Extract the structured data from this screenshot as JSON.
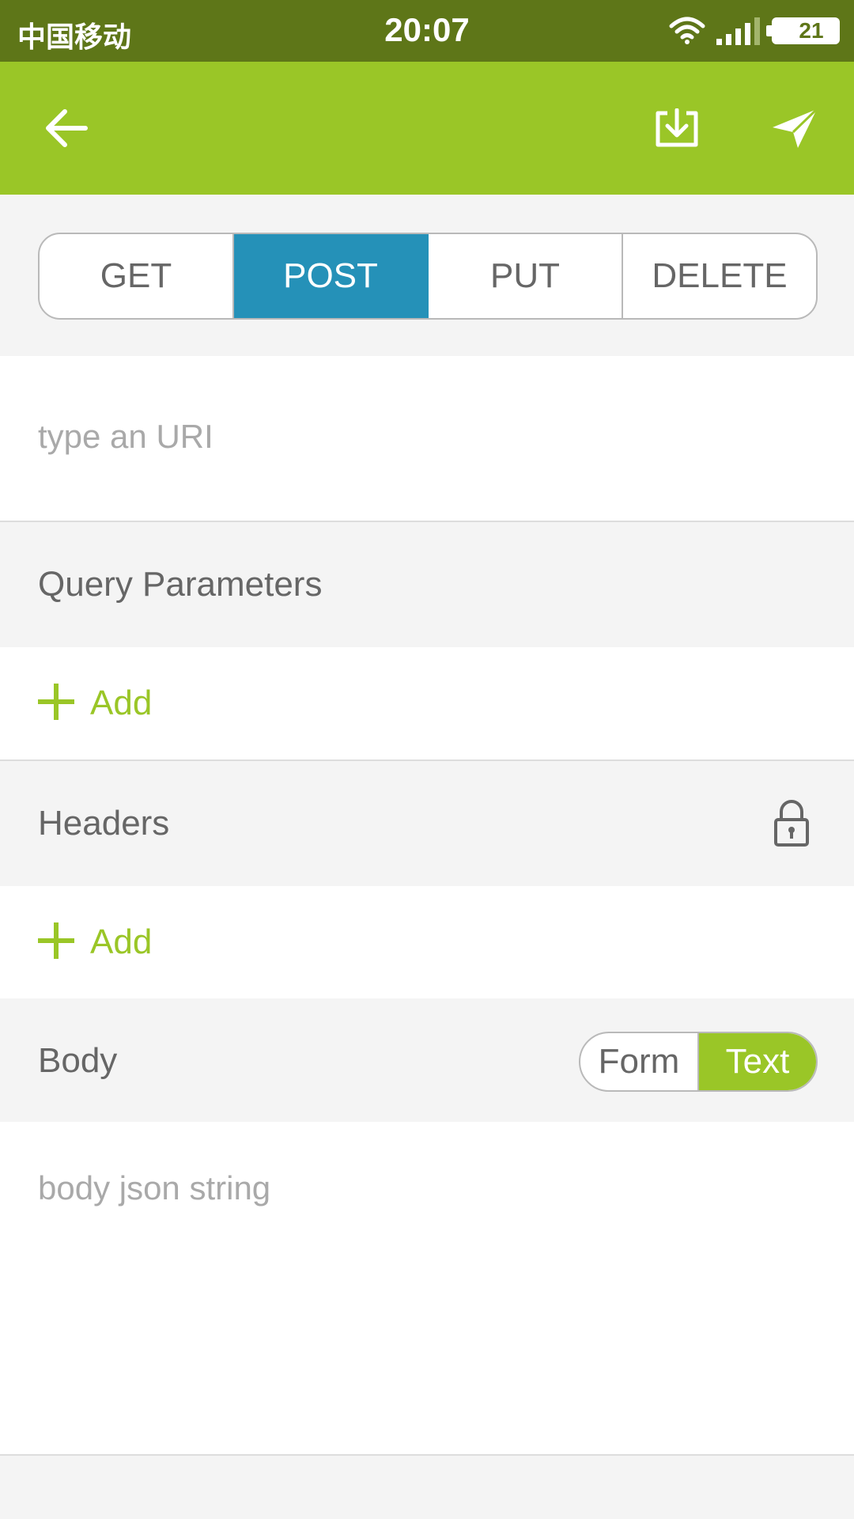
{
  "status_bar": {
    "carrier": "中国移动",
    "time": "20:07",
    "battery": "21"
  },
  "app_bar": {
    "back_icon": "arrow-left-icon",
    "download_icon": "download-icon",
    "send_icon": "paper-plane-icon"
  },
  "methods": {
    "options": [
      "GET",
      "POST",
      "PUT",
      "DELETE"
    ],
    "selected": "POST",
    "selected_color": "#2591b8"
  },
  "uri": {
    "placeholder": "type an URI"
  },
  "query_parameters": {
    "title": "Query Parameters",
    "add_label": "Add"
  },
  "headers": {
    "title": "Headers",
    "add_label": "Add",
    "lock_icon": "lock-icon"
  },
  "body": {
    "title": "Body",
    "modes": [
      "Form",
      "Text"
    ],
    "selected_mode": "Text",
    "placeholder": "body json string"
  },
  "colors": {
    "accent": "#9ac627",
    "status_bar": "#5e7618"
  }
}
